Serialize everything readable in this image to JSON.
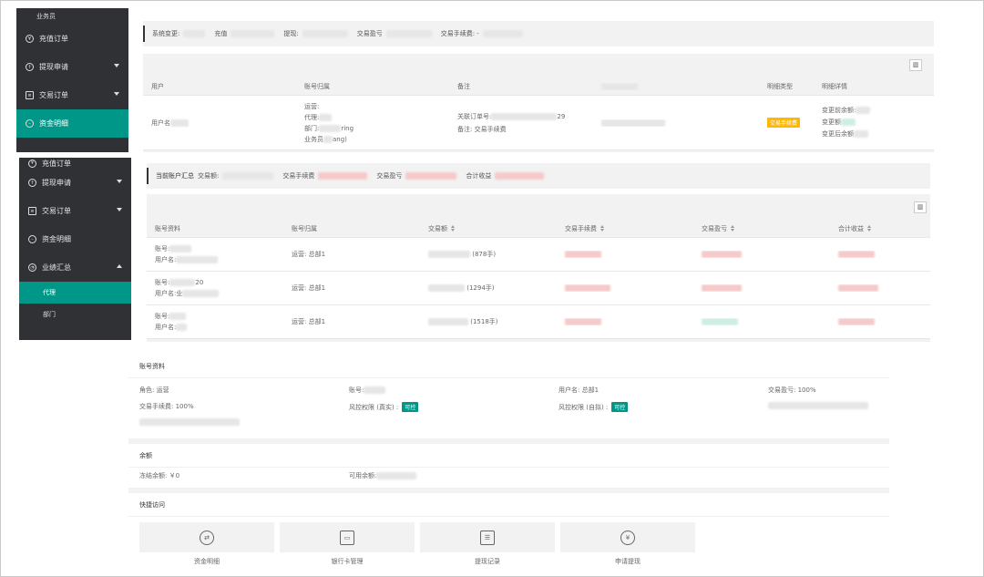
{
  "sidebar_top": {
    "header": "业务员",
    "items": [
      {
        "label": "充值订单",
        "icon": "yen-circle-icon"
      },
      {
        "label": "提现申请",
        "icon": "withdraw-icon"
      },
      {
        "label": "交易订单",
        "icon": "order-icon"
      },
      {
        "label": "资金明细",
        "icon": "funds-icon",
        "active": true
      }
    ]
  },
  "sidebar_bottom": {
    "items": [
      {
        "label": "充值订单",
        "icon": "yen-circle-icon"
      },
      {
        "label": "提现申请",
        "icon": "withdraw-icon"
      },
      {
        "label": "交易订单",
        "icon": "order-icon"
      },
      {
        "label": "资金明细",
        "icon": "funds-icon"
      },
      {
        "label": "业绩汇总",
        "icon": "chart-icon",
        "expanded": true
      }
    ],
    "subitems": [
      {
        "label": "代理",
        "active": true
      },
      {
        "label": "部门"
      }
    ]
  },
  "summary_bar": {
    "system_change": "系统变更:",
    "recharge": "充值",
    "withdraw": "提现:",
    "trade_profit": "交易盈亏",
    "trade_fee": "交易手续费: -"
  },
  "detail_table": {
    "headers": [
      "用户",
      "账号归属",
      "备注",
      "",
      "明细类型",
      "明细详情"
    ],
    "row": {
      "user": "用户名",
      "ops": "运营:",
      "agent": "代理:",
      "dept": "部门:",
      "dept_suffix": "ring",
      "salesman": "业务员",
      "salesman_suffix": "ang)",
      "order_no": "关联订单号:",
      "order_suffix": "29",
      "remark": "备注: 交易手续费",
      "type_tag": "交易手续费",
      "before": "变更前余额:",
      "change": "变更额",
      "after": "变更后余额"
    }
  },
  "account_summary": {
    "title": "当前账户汇总",
    "trade_amount": "交易额:",
    "trade_fee": "交易手续费",
    "trade_profit": "交易盈亏",
    "total_income": "合计收益"
  },
  "account_table": {
    "headers": [
      "账号资料",
      "账号归属",
      "交易额",
      "交易手续费",
      "交易盈亏",
      "合计收益"
    ],
    "rows": [
      {
        "account": "账号:",
        "username": "用户名:",
        "owner": "运营: 总部1",
        "lots": "(878手)"
      },
      {
        "account": "账号:",
        "username": "用户名:",
        "owner": "运营: 总部1",
        "lots": "(1294手)"
      },
      {
        "account": "账号:",
        "username": "用户名:",
        "owner": "运营: 总部1",
        "lots": "(1518手)"
      }
    ],
    "row1_suffix": "20",
    "row1_user_prefix": "业"
  },
  "profile": {
    "title": "账号资料",
    "role": "角色: 运营",
    "account": "账号:",
    "username": "用户名: 总部1",
    "trade_pl": "交易盈亏: 100%",
    "trade_fee": "交易手续费: 100%",
    "risk_real": "风控权限 (真实) :",
    "risk_sim": "风控权限 (自拟) :",
    "risk_tag": "可控"
  },
  "balance": {
    "title": "余额",
    "frozen": "冻结余额: ￥0",
    "available": "可用余额:"
  },
  "quick_access": {
    "title": "快捷访问",
    "items": [
      {
        "label": "资金明细",
        "icon": "exchange-icon"
      },
      {
        "label": "银行卡管理",
        "icon": "bank-card-icon"
      },
      {
        "label": "提现记录",
        "icon": "clipboard-icon"
      },
      {
        "label": "申请提现",
        "icon": "yen-icon"
      }
    ]
  }
}
